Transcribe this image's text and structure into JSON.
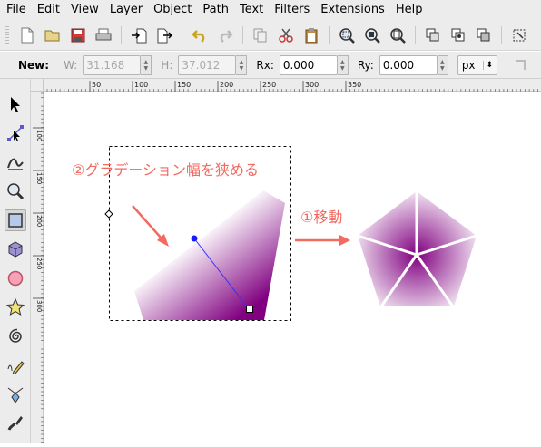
{
  "menubar": {
    "items": [
      "File",
      "Edit",
      "View",
      "Layer",
      "Object",
      "Path",
      "Text",
      "Filters",
      "Extensions",
      "Help"
    ]
  },
  "toolbar": {
    "buttons": [
      "new-document-icon",
      "open-icon",
      "save-icon",
      "print-icon",
      "import-icon",
      "export-icon",
      "undo-icon",
      "redo-icon",
      "copy-icon",
      "cut-icon",
      "paste-icon",
      "zoom-selection-icon",
      "zoom-drawing-icon",
      "zoom-page-icon",
      "duplicate-icon",
      "clone-icon",
      "unlink-clone-icon",
      "select-all-icon"
    ]
  },
  "ctrlbar": {
    "new_label": "New:",
    "w_label": "W:",
    "w_value": "31.168",
    "h_label": "H:",
    "h_value": "37.012",
    "rx_label": "Rx:",
    "rx_value": "0.000",
    "ry_label": "Ry:",
    "ry_value": "0.000",
    "unit": "px"
  },
  "toolbox": {
    "tools": [
      "selector-tool-icon",
      "node-tool-icon",
      "tweak-tool-icon",
      "zoom-tool-icon",
      "rectangle-tool-icon",
      "3d-box-tool-icon",
      "ellipse-tool-icon",
      "star-tool-icon",
      "spiral-tool-icon",
      "pencil-tool-icon",
      "pen-tool-icon",
      "calligraphy-tool-icon"
    ],
    "active": "rectangle-tool-icon"
  },
  "rulers": {
    "h_labels": [
      "50",
      "100",
      "150",
      "200",
      "250",
      "300",
      "350"
    ],
    "v_labels": [
      "100",
      "150",
      "200",
      "250",
      "300"
    ]
  },
  "canvas": {
    "annotation_narrow": "②グラデーション幅を狭める",
    "annotation_move": "①移動",
    "accent_color": "#f26a60",
    "gradient_color": "#800080"
  }
}
